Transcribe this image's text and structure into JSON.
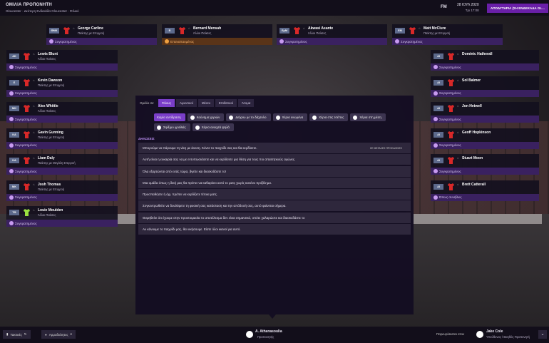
{
  "topbar": {
    "title": "ΟΜΙΛΙΑ ΠΡΟΠΟΝΗΤΗ",
    "crumbs": "Gloucester  ·  Δεύτερη Ενδεκάδα Gloucester  ·  Φιλικό",
    "logo": "FM",
    "date": "28 ΙΟΥΛ 2020",
    "time": "Τρι 17:08",
    "continue_label": "ΑΠΟΔΥΤΗΡΙΑ (ΣΗ ΕΝΔΕΚΑΔΑ GL..."
  },
  "accent": "#7a3ec8",
  "players_top": [
    {
      "pos": "ΦΜΚ",
      "name": "George Carline",
      "role": "Παίκτης με Επιρροή",
      "status": "Συγκρατημένος",
      "warn": false
    },
    {
      "pos": "Β",
      "name": "Bernard Mensah",
      "role": "Άλλοι Παίκτες",
      "status": "Επαναπαυμένος",
      "warn": true
    },
    {
      "pos": "ΕμΜ",
      "name": "Akwasi Asante",
      "role": "Άλλοι Παίκτες",
      "status": "Συγκρατημένος",
      "warn": false
    },
    {
      "pos": "ΕΜ",
      "name": "Matt McClure",
      "role": "Παίκτης με Επιρροή",
      "status": "Συγκρατημένος",
      "warn": false
    }
  ],
  "players_left": [
    {
      "pos": "ΑΚ",
      "name": "Lewis Blunt",
      "role": "Άλλοι Παίκτες",
      "status": "Συγκρατημένος"
    },
    {
      "pos": "Ε",
      "name": "Kevin Dawson",
      "role": "Παίκτης με Επιρροή",
      "status": "Συγκρατημένος"
    },
    {
      "pos": "ΜΚ",
      "name": "Alex Whittle",
      "role": "Άλλοι Παίκτες",
      "status": "Συγκρατημένος"
    },
    {
      "pos": "ΚΑ",
      "name": "Gavin Gunning",
      "role": "Παίκτης με Επιρροή",
      "status": "Συγκρατημένος"
    },
    {
      "pos": "ΚΑ",
      "name": "Liam Daly",
      "role": "Παίκτης με Μεγάλη Επιρροή",
      "status": "Συγκρατημένος"
    },
    {
      "pos": "ΜΚ",
      "name": "Josh Thomas",
      "role": "Παίκτης με Επιρροή",
      "status": "Συγκρατημένος"
    },
    {
      "pos": "ΤΦ",
      "name": "Louie Moulden",
      "role": "Άλλοι Παίκτες",
      "status": "Συγκρατημένος"
    }
  ],
  "players_right": [
    {
      "pos": "ΑΙ",
      "name": "Dominic Hatherall",
      "role": "",
      "status": "Συγκρατημένος"
    },
    {
      "pos": "ΑΙ",
      "name": "Sol Balmer",
      "role": "",
      "status": "Συγκρατημένος"
    },
    {
      "pos": "ΑΙ",
      "name": "Jon Hetwell",
      "role": "",
      "status": "Συγκρατημένος"
    },
    {
      "pos": "ΑΙ",
      "name": "Geoff Hopkinson",
      "role": "",
      "status": "Συγκρατημένος"
    },
    {
      "pos": "ΑΙ",
      "name": "Stuart Moon",
      "role": "",
      "status": "Συγκρατημένος"
    },
    {
      "pos": "ΑΙ",
      "name": "Brett Catterall",
      "role": "",
      "status": "Ώπως συνήθως"
    }
  ],
  "panel": {
    "talk_to_label": "Ομιλία σε:",
    "tabs": [
      "Όλους",
      "Αμυντικοί",
      "Μέσοι",
      "Επιθετικοί",
      "Άτομα"
    ],
    "tones": [
      "Καμία αντίδραση",
      "Κούνημα χεριών",
      "Δείχνω με το δάχτυλο",
      "Χέρια ενωμένα",
      "Χέρια στις τσέπες",
      "Χέρια στη μέση",
      "Σφίξιμο γροθιάς",
      "Χέρια ανοιχτά ψηλά"
    ],
    "section": "ΔΗΛΩΣΕΙΣ",
    "lines": [
      "Μπορούμε να πάρουμε τη νίκη με άνεση. Κόντε το παιχνίδι σας και θα κερδίσετε.",
      "Αυτή είναι η ευκαιρία σας να με εντυπωσιάσετε και να κερδίσετε μια θέση για τους πιο απαιτητικούς αγώνες.",
      "Όλα εξαρτώνται από εσάς τώρα, βγείτε και διασκεδάστε το!",
      "Μια ομάδα όπως η δική μας θα πρέπει να καθαρίσει αυτό το ματς χωρίς κανένα πρόβλημα.",
      "Προσπαθήστε ή όχι, πρέπει να κερδίζετε τέτοια ματς.",
      "Συγκεντρωθείτε να δουλέψετε τη φυσική σας κατάσταση και την απόδοσή σας, αυτό φαίνεται σήμερα.",
      "Θυμηθείτε ότι έχουμε στην προετοιμασία το αποτέλεσμα δεν είναι σημαντικό, οπότε χαλαρώστε και διασκεδάστε το",
      "Αν κάνουμε το παιχνίδι μας, θα νικήσουμε. Είστε όλοι ικανοί για αυτό."
    ],
    "line_tag": "ΣΕ ΜΕΓΑΛΕΣ ΠΡΟΣΔΟΚΙΕΣ"
  },
  "bottombar": {
    "tactics_label": "Τακτικές",
    "assistant_btn": "Αρμοδιότητες",
    "speaker_name": "A. Athanasoulia",
    "speaker_role": "Προπονητής",
    "present_label": "Παρευρίσκεται στον",
    "assistant_name": "Jake Cole",
    "assistant_role": "Υπεύθυνος / Βοηθός Προπονητή"
  }
}
